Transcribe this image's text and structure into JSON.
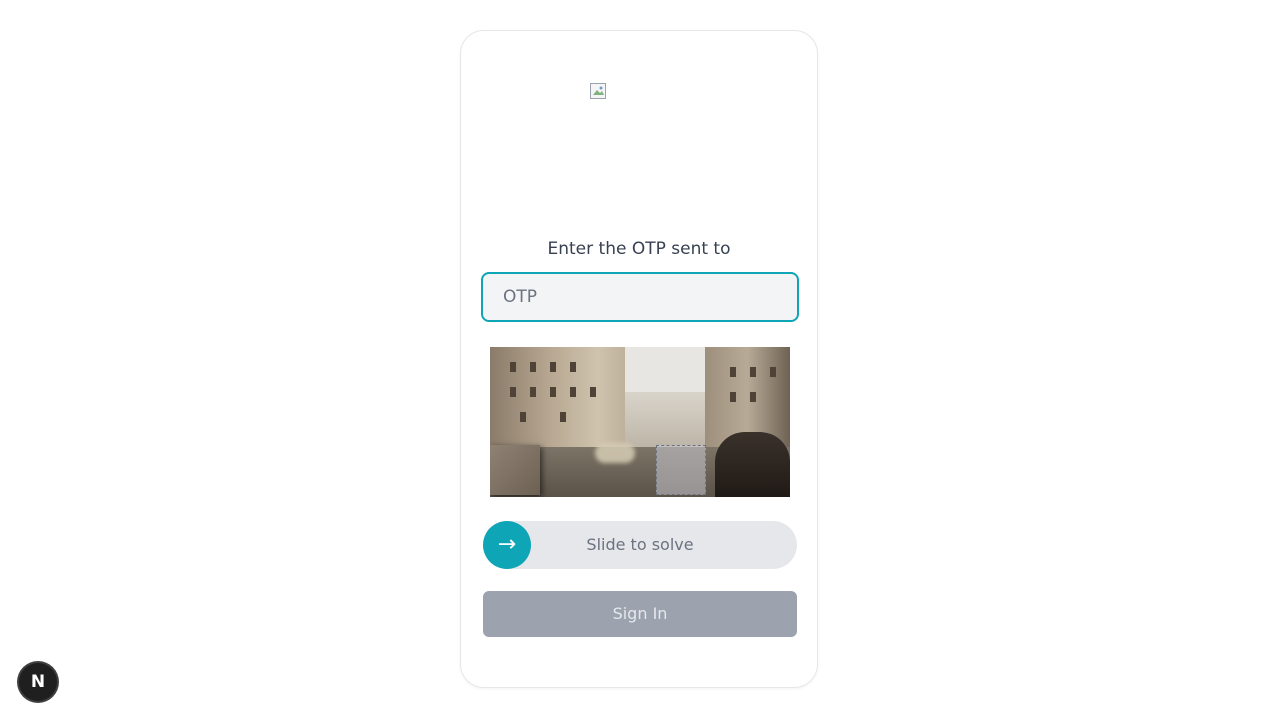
{
  "form": {
    "otp_label": "Enter the OTP sent to",
    "otp_value": "",
    "otp_placeholder": "OTP"
  },
  "captcha": {
    "slider_label": "Slide to solve",
    "slider_icon": "arrow-right-icon",
    "slider_glyph": "→",
    "slider_progress": 0
  },
  "actions": {
    "sign_in_label": "Sign In"
  },
  "dev_badge": {
    "icon": "nextjs-icon",
    "glyph": "N"
  },
  "colors": {
    "accent": "#0ea5b7",
    "disabled_button": "#9ca3af"
  }
}
